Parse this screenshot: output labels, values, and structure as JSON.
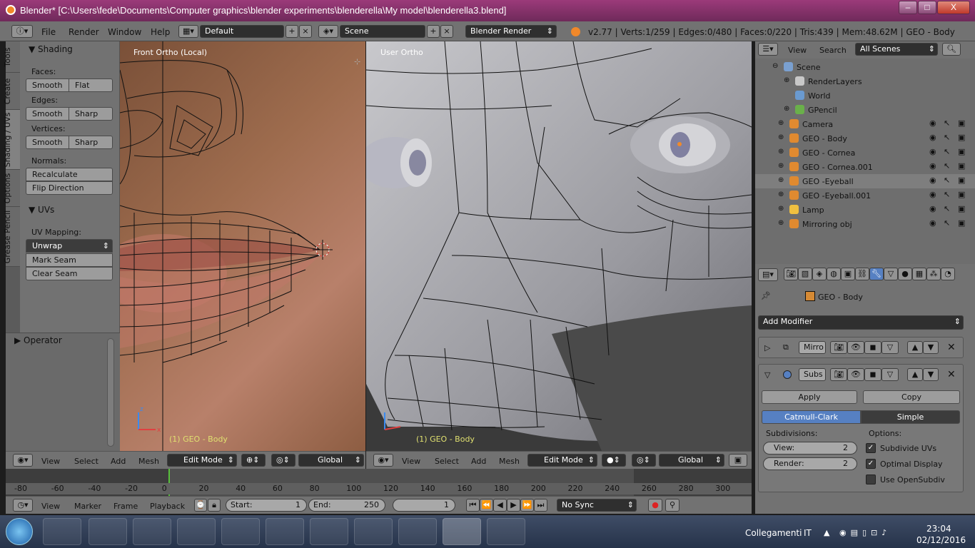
{
  "window": {
    "title": "Blender* [C:\\Users\\fede\\Documents\\Computer graphics\\blender experiments\\blenderella\\My model\\blenderella3.blend]",
    "minimize": "–",
    "maximize": "□",
    "close": "X"
  },
  "topbar": {
    "menus": [
      "File",
      "Render",
      "Window",
      "Help"
    ],
    "layout": "Default",
    "scene": "Scene",
    "engine": "Blender Render",
    "stats": "v2.77 | Verts:1/259 | Edges:0/480 | Faces:0/220 | Tris:439 | Mem:48.62M | GEO - Body"
  },
  "toolshelf": {
    "tabs": [
      "Tools",
      "Create",
      "Shading / UVs",
      "Options",
      "Grease Pencil"
    ],
    "shading": {
      "title": "Shading",
      "faces_label": "Faces:",
      "smooth": "Smooth",
      "flat": "Flat",
      "edges_label": "Edges:",
      "sharp": "Sharp",
      "vertices_label": "Vertices:",
      "normals_label": "Normals:",
      "recalculate": "Recalculate",
      "flip": "Flip Direction"
    },
    "uvs": {
      "title": "UVs",
      "mapping_label": "UV Mapping:",
      "unwrap": "Unwrap",
      "mark_seam": "Mark Seam",
      "clear_seam": "Clear Seam"
    },
    "operator": "Operator"
  },
  "viewport_left": {
    "label": "Front Ortho (Local)",
    "object": "(1) GEO - Body",
    "menus": [
      "View",
      "Select",
      "Add",
      "Mesh"
    ],
    "mode": "Edit Mode",
    "orientation": "Global"
  },
  "viewport_right": {
    "label": "User Ortho",
    "object": "(1) GEO - Body",
    "menus": [
      "View",
      "Select",
      "Add",
      "Mesh"
    ],
    "mode": "Edit Mode",
    "orientation": "Global"
  },
  "timeline": {
    "ticks": [
      "-80",
      "-60",
      "-40",
      "-20",
      "0",
      "20",
      "40",
      "60",
      "80",
      "100",
      "120",
      "140",
      "160",
      "180",
      "200",
      "220",
      "240",
      "260",
      "280",
      "300"
    ],
    "menus": [
      "View",
      "Marker",
      "Frame",
      "Playback"
    ],
    "start_label": "Start:",
    "start": "1",
    "end_label": "End:",
    "end": "250",
    "current": "1",
    "sync": "No Sync"
  },
  "outliner": {
    "menus": [
      "View",
      "Search"
    ],
    "filter": "All Scenes",
    "items": [
      "Scene",
      "RenderLayers",
      "World",
      "GPencil",
      "Camera",
      "GEO - Body",
      "GEO - Cornea",
      "GEO - Cornea.001",
      "GEO -Eyeball",
      "GEO -Eyeball.001",
      "Lamp",
      "Mirroring obj"
    ]
  },
  "properties": {
    "object": "GEO - Body",
    "add_modifier": "Add Modifier",
    "mod1": "Mirro",
    "mod2": "Subs",
    "apply": "Apply",
    "copy": "Copy",
    "catmull": "Catmull-Clark",
    "simple": "Simple",
    "subdiv_label": "Subdivisions:",
    "options_label": "Options:",
    "view_label": "View:",
    "view_val": "2",
    "render_label": "Render:",
    "render_val": "2",
    "opt1": "Subdivide UVs",
    "opt2": "Optimal Display",
    "opt3": "Use OpenSubdiv"
  },
  "taskbar": {
    "network": "Collegamenti",
    "lang": "IT",
    "time": "23:04",
    "date": "02/12/2016"
  }
}
